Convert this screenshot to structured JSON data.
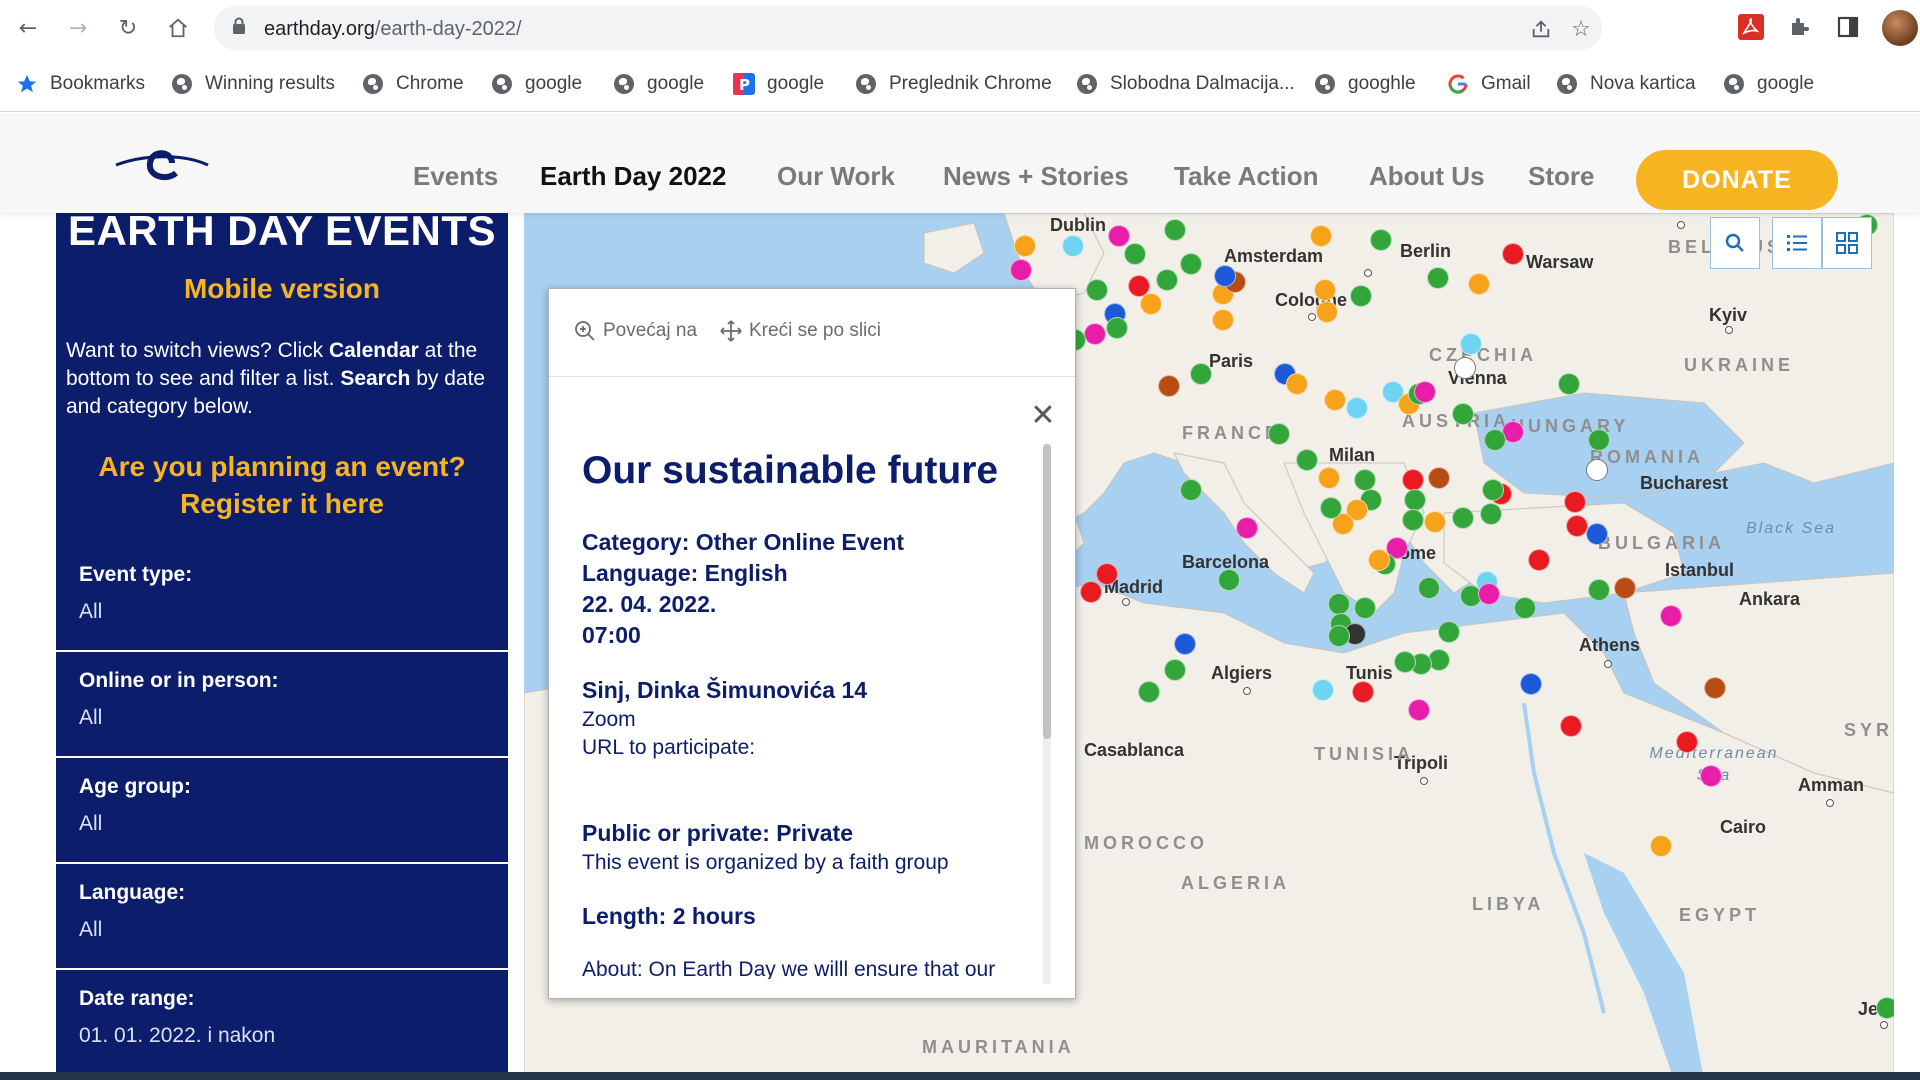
{
  "browser": {
    "url_host": "earthday.org",
    "url_path": "/earth-day-2022/",
    "bookmarks": [
      {
        "label": "Bookmarks",
        "icon": "star-icon"
      },
      {
        "label": "Winning results",
        "icon": "globe-icon"
      },
      {
        "label": "Chrome",
        "icon": "globe-icon"
      },
      {
        "label": "google",
        "icon": "globe-icon"
      },
      {
        "label": "google",
        "icon": "globe-icon"
      },
      {
        "label": "google",
        "icon": "p-logo-icon"
      },
      {
        "label": "Preglednik Chrome",
        "icon": "globe-icon"
      },
      {
        "label": "Slobodna Dalmacija...",
        "icon": "globe-icon"
      },
      {
        "label": "googhle",
        "icon": "globe-icon"
      },
      {
        "label": "Gmail",
        "icon": "google-g-icon"
      },
      {
        "label": "Nova kartica",
        "icon": "globe-icon"
      },
      {
        "label": "google",
        "icon": "globe-icon"
      }
    ]
  },
  "site": {
    "menu": [
      "Events",
      "Earth Day 2022",
      "Our Work",
      "News + Stories",
      "Take Action",
      "About Us",
      "Store"
    ],
    "active_menu": "Earth Day 2022",
    "donate_label": "DONATE",
    "colors": {
      "navy": "#0b1d6b",
      "accent": "#f7b422"
    }
  },
  "panel": {
    "title": "EARTH DAY EVENTS",
    "mobile": "Mobile version",
    "desc_1": "Want to switch views? Click ",
    "desc_calendar": "Calendar",
    "desc_2": " at the bottom to see and filter a list. ",
    "desc_search": "Search",
    "desc_3": " by date and category below.",
    "plan_line1": "Are you planning an event?",
    "plan_line2": "Register it here",
    "filters": [
      {
        "label": "Event type:",
        "value": "All"
      },
      {
        "label": "Online or in person:",
        "value": "All"
      },
      {
        "label": "Age group:",
        "value": "All"
      },
      {
        "label": "Language:",
        "value": "All"
      },
      {
        "label": "Date range:",
        "value": "01. 01. 2022. i nakon"
      }
    ]
  },
  "map": {
    "cities": [
      "Dublin",
      "Amsterdam",
      "Berlin",
      "Warsaw",
      "Cologne",
      "Kyiv",
      "Paris",
      "Vienna",
      "Milan",
      "Bucharest",
      "Barcelona",
      "Istanbul",
      "Madrid",
      "Ankara",
      "Algiers",
      "Tunis",
      "Athens",
      "Tripoli",
      "Amman",
      "Cairo",
      "Rome",
      "Casablanca",
      "Jeddah"
    ],
    "countries": [
      "BELARUS",
      "UKRAINE",
      "CZECHIA",
      "FRANCE",
      "AUSTRIA",
      "HUNGARY",
      "ROMANIA",
      "BULGARIA",
      "TUNISIA",
      "ALGERIA",
      "LIBYA",
      "EGYPT",
      "MAURITANIA",
      "SYRIA",
      "MOROCCO"
    ],
    "seas": [
      "Black Sea",
      "Mediterranean Sea"
    ]
  },
  "popup": {
    "zoom_label": "Povećaj na",
    "pan_label": "Kreći se po slici",
    "title": "Our sustainable future",
    "category": "Category: Other Online Event",
    "language": "Language: English",
    "date": "22. 04. 2022.",
    "time": "07:00",
    "location": "Sinj, Dinka Šimunovića 14",
    "platform": "Zoom",
    "url_label": "URL to participate:",
    "public_private": "Public or private: Private",
    "organized": "This event is organized by a faith group",
    "length": "Length: 2 hours",
    "about": "About: On Earth Day we willl ensure that our"
  }
}
